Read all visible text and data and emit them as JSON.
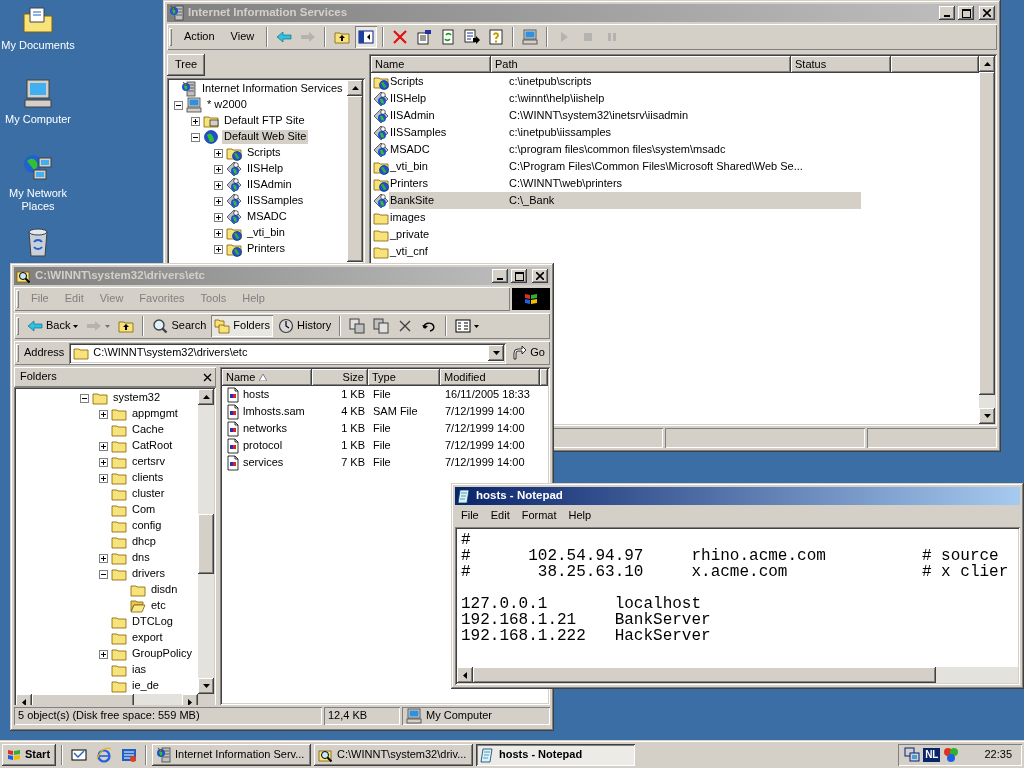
{
  "desktop": {
    "icons": [
      {
        "kind": "documents",
        "label": "My Documents"
      },
      {
        "kind": "computer",
        "label": "My Computer"
      },
      {
        "kind": "network",
        "label": "My Network Places"
      },
      {
        "kind": "recycle"
      }
    ]
  },
  "iis": {
    "title": "Internet Information Services",
    "active": false,
    "menu": [
      "Action",
      "View"
    ],
    "toolbar": [
      {
        "kind": "back",
        "disabled": false,
        "pressed": false
      },
      {
        "kind": "forward",
        "disabled": true,
        "pressed": false
      },
      {
        "kind": "up",
        "disabled": false,
        "pressed": false
      },
      {
        "kind": "tree",
        "disabled": false,
        "pressed": true
      },
      {
        "kind": "delete",
        "disabled": false,
        "pressed": false
      },
      {
        "kind": "properties",
        "disabled": false,
        "pressed": false
      },
      {
        "kind": "refresh",
        "disabled": false,
        "pressed": false
      },
      {
        "kind": "export",
        "disabled": false,
        "pressed": false
      },
      {
        "kind": "help",
        "disabled": false,
        "pressed": false
      },
      {
        "kind": "computer",
        "disabled": false,
        "pressed": false
      },
      {
        "kind": "play",
        "disabled": true,
        "pressed": false
      },
      {
        "kind": "stop",
        "disabled": true,
        "pressed": false
      },
      {
        "kind": "pause",
        "disabled": true,
        "pressed": false
      }
    ],
    "tree_tab": "Tree",
    "tree": [
      {
        "label": "Internet Information Services",
        "kind": "iis",
        "selected": false,
        "children": [
          {
            "label": "* w2000",
            "kind": "server",
            "expanded": true,
            "selected": false,
            "children": [
              {
                "label": "Default FTP Site",
                "kind": "ftp",
                "expanded": false,
                "selected": false
              },
              {
                "label": "Default Web Site",
                "kind": "web",
                "expanded": true,
                "selected": true,
                "children": [
                  {
                    "label": "Scripts",
                    "kind": "vdir",
                    "expanded": false,
                    "selected": false
                  },
                  {
                    "label": "IISHelp",
                    "kind": "app",
                    "expanded": false,
                    "selected": false
                  },
                  {
                    "label": "IISAdmin",
                    "kind": "app",
                    "expanded": false,
                    "selected": false
                  },
                  {
                    "label": "IISSamples",
                    "kind": "app",
                    "expanded": false,
                    "selected": false
                  },
                  {
                    "label": "MSADC",
                    "kind": "app",
                    "expanded": false,
                    "selected": false
                  },
                  {
                    "label": "_vti_bin",
                    "kind": "vdir",
                    "expanded": false,
                    "selected": false
                  },
                  {
                    "label": "Printers",
                    "kind": "vdir",
                    "expanded": false,
                    "selected": false
                  }
                ]
              }
            ]
          }
        ]
      }
    ],
    "columns": [
      "Name",
      "Path",
      "Status"
    ],
    "rows": [
      {
        "kind": "vdir",
        "name": "Scripts",
        "path": "c:\\inetpub\\scripts",
        "selected": false
      },
      {
        "kind": "app",
        "name": "IISHelp",
        "path": "c:\\winnt\\help\\iishelp",
        "selected": false
      },
      {
        "kind": "app",
        "name": "IISAdmin",
        "path": "C:\\WINNT\\system32\\inetsrv\\iisadmin",
        "selected": false
      },
      {
        "kind": "app",
        "name": "IISSamples",
        "path": "c:\\inetpub\\iissamples",
        "selected": false
      },
      {
        "kind": "app",
        "name": "MSADC",
        "path": "c:\\program files\\common files\\system\\msadc",
        "selected": false
      },
      {
        "kind": "vdir",
        "name": "_vti_bin",
        "path": "C:\\Program Files\\Common Files\\Microsoft Shared\\Web Se...",
        "selected": false
      },
      {
        "kind": "vdir",
        "name": "Printers",
        "path": "C:\\WINNT\\web\\printers",
        "selected": false
      },
      {
        "kind": "app",
        "name": "BankSite",
        "path": "C:\\_Bank",
        "selected": true
      },
      {
        "kind": "folder",
        "name": "images",
        "selected": false
      },
      {
        "kind": "folder",
        "name": "_private",
        "selected": false
      },
      {
        "kind": "folder",
        "name": "_vti_cnf",
        "selected": false
      }
    ]
  },
  "explorer": {
    "title": "C:\\WINNT\\system32\\drivers\\etc",
    "active": false,
    "menu": [
      "File",
      "Edit",
      "View",
      "Favorites",
      "Tools",
      "Help"
    ],
    "toolbar": [
      {
        "kind": "back",
        "label": "Back",
        "disabled": false,
        "pressed": false
      },
      {
        "kind": "forward",
        "disabled": true,
        "pressed": false
      },
      {
        "kind": "up",
        "disabled": false,
        "pressed": false
      },
      {
        "kind": "search",
        "label": "Search",
        "disabled": false,
        "pressed": false
      },
      {
        "kind": "folders",
        "label": "Folders",
        "disabled": false,
        "pressed": true
      },
      {
        "kind": "history",
        "label": "History",
        "disabled": false,
        "pressed": false
      },
      {
        "kind": "move",
        "disabled": false,
        "pressed": false
      },
      {
        "kind": "copy",
        "disabled": false,
        "pressed": false
      },
      {
        "kind": "delete",
        "disabled": false,
        "pressed": false
      },
      {
        "kind": "undo",
        "disabled": false,
        "pressed": false
      },
      {
        "kind": "views",
        "disabled": false,
        "pressed": false
      }
    ],
    "address": {
      "label": "Address",
      "value": "C:\\WINNT\\system32\\drivers\\etc",
      "go": "Go"
    },
    "folders_pane": {
      "title": "Folders",
      "tree": [
        {
          "label": "system32",
          "expanded": true,
          "selected": false,
          "children": [
            {
              "label": "appmgmt",
              "expanded": false,
              "selected": false
            },
            {
              "label": "Cache",
              "selected": false
            },
            {
              "label": "CatRoot",
              "expanded": false,
              "selected": false
            },
            {
              "label": "certsrv",
              "expanded": false,
              "selected": false
            },
            {
              "label": "clients",
              "expanded": false,
              "selected": false
            },
            {
              "label": "cluster",
              "selected": false
            },
            {
              "label": "Com",
              "selected": false
            },
            {
              "label": "config",
              "selected": false
            },
            {
              "label": "dhcp",
              "selected": false
            },
            {
              "label": "dns",
              "expanded": false,
              "selected": false
            },
            {
              "label": "drivers",
              "expanded": true,
              "selected": false,
              "children": [
                {
                  "label": "disdn",
                  "selected": false
                },
                {
                  "label": "etc",
                  "selected": true
                }
              ]
            },
            {
              "label": "DTCLog",
              "selected": false
            },
            {
              "label": "export",
              "selected": false
            },
            {
              "label": "GroupPolicy",
              "expanded": false,
              "selected": false
            },
            {
              "label": "ias",
              "selected": false
            },
            {
              "label": "ie_de",
              "selected": false
            }
          ]
        }
      ]
    },
    "columns": [
      {
        "label": "Name",
        "sorted": true
      },
      {
        "label": "Size",
        "sorted": false
      },
      {
        "label": "Type",
        "sorted": false
      },
      {
        "label": "Modified",
        "sorted": false
      }
    ],
    "files": [
      {
        "name": "hosts",
        "size": "1 KB",
        "type": "File",
        "modified": "16/11/2005 18:33"
      },
      {
        "name": "lmhosts.sam",
        "size": "4 KB",
        "type": "SAM File",
        "modified": "7/12/1999 14:00"
      },
      {
        "name": "networks",
        "size": "1 KB",
        "type": "File",
        "modified": "7/12/1999 14:00"
      },
      {
        "name": "protocol",
        "size": "1 KB",
        "type": "File",
        "modified": "7/12/1999 14:00"
      },
      {
        "name": "services",
        "size": "7 KB",
        "type": "File",
        "modified": "7/12/1999 14:00"
      }
    ],
    "status_bar": [
      "5 object(s) (Disk free space: 559 MB)",
      "12,4 KB",
      "My Computer"
    ]
  },
  "notepad": {
    "title": "hosts - Notepad",
    "active": true,
    "menu": [
      "File",
      "Edit",
      "Format",
      "Help"
    ],
    "blocks": [
      [
        "#",
        "#      102.54.94.97     rhino.acme.com          # source",
        "#       38.25.63.10     x.acme.com              # x clier"
      ],
      [
        "127.0.0.1       localhost",
        "192.168.1.21    BankServer",
        "192.168.1.222   HackServer"
      ]
    ]
  },
  "taskbar": {
    "start": "Start",
    "quick_launch": [
      {
        "kind": "desktop"
      },
      {
        "kind": "browser"
      },
      {
        "kind": "channels"
      }
    ],
    "tasks": [
      {
        "kind": "iis",
        "label": "Internet Information Serv...",
        "selected": false
      },
      {
        "kind": "explorer",
        "label": "C:\\WINNT\\system32\\driv...",
        "selected": false
      },
      {
        "kind": "notepad",
        "label": "hosts - Notepad",
        "selected": true
      }
    ],
    "tray": [
      {
        "kind": "network"
      },
      {
        "kind": "language",
        "label": "NL"
      },
      {
        "kind": "flag"
      }
    ],
    "clock": "22:35"
  }
}
